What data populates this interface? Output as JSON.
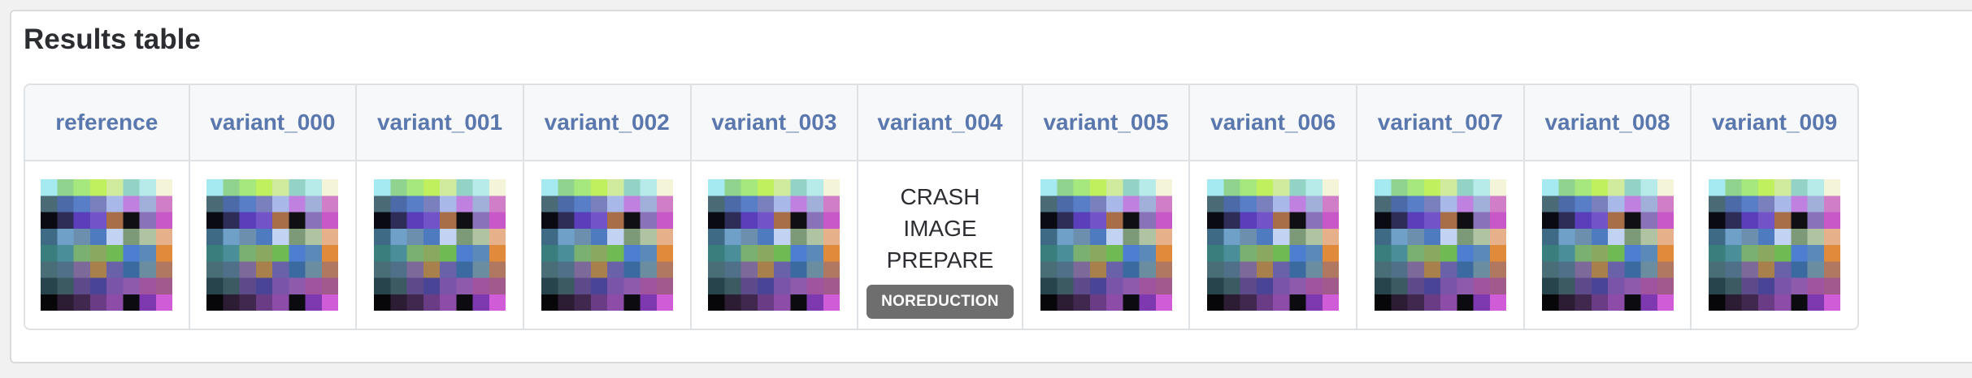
{
  "title": "Results table",
  "columns": [
    {
      "label": "reference",
      "type": "image"
    },
    {
      "label": "variant_000",
      "type": "image"
    },
    {
      "label": "variant_001",
      "type": "image"
    },
    {
      "label": "variant_002",
      "type": "image"
    },
    {
      "label": "variant_003",
      "type": "image"
    },
    {
      "label": "variant_004",
      "type": "crash",
      "crash_lines": [
        "CRASH",
        "IMAGE",
        "PREPARE"
      ],
      "badge": "NOREDUCTION"
    },
    {
      "label": "variant_005",
      "type": "image"
    },
    {
      "label": "variant_006",
      "type": "image"
    },
    {
      "label": "variant_007",
      "type": "image"
    },
    {
      "label": "variant_008",
      "type": "image"
    },
    {
      "label": "variant_009",
      "type": "image"
    }
  ],
  "thumbnail_palette": [
    [
      "#a4eaf0",
      "#8fd38f",
      "#a6e87d",
      "#c1f05e",
      "#d0eb9e",
      "#92d3c5",
      "#b6ebea",
      "#f4f4d8"
    ],
    [
      "#4a6a76",
      "#4d6aa8",
      "#587ec8",
      "#7a7fbd",
      "#a8b8e8",
      "#c080e0",
      "#a0b0d8",
      "#d07ec8"
    ],
    [
      "#0a0a12",
      "#2d2d58",
      "#5a3eba",
      "#7254c8",
      "#a86e48",
      "#101014",
      "#8a72b8",
      "#c858c8"
    ],
    [
      "#3e6a86",
      "#6fa0c8",
      "#6d8fae",
      "#4e7ac0",
      "#c2d2f2",
      "#7d9a78",
      "#b0c4a4",
      "#e6b08a"
    ],
    [
      "#3b7e7e",
      "#4a8e9a",
      "#7ab070",
      "#8aa860",
      "#6fba52",
      "#4e7ed0",
      "#5c8ab8",
      "#e08a3c"
    ],
    [
      "#4a6e78",
      "#4f7088",
      "#7d6a9a",
      "#a8804c",
      "#6a62a8",
      "#3a6aa0",
      "#6a8ea0",
      "#b07860"
    ],
    [
      "#27444c",
      "#3c5a62",
      "#5d4a8a",
      "#4a4496",
      "#7a54a8",
      "#8e5aac",
      "#a054a0",
      "#a05a8c"
    ],
    [
      "#07070a",
      "#2c1c34",
      "#40284e",
      "#6a3c86",
      "#8c4ca8",
      "#0c0c10",
      "#7e38b0",
      "#d05cd8"
    ]
  ]
}
